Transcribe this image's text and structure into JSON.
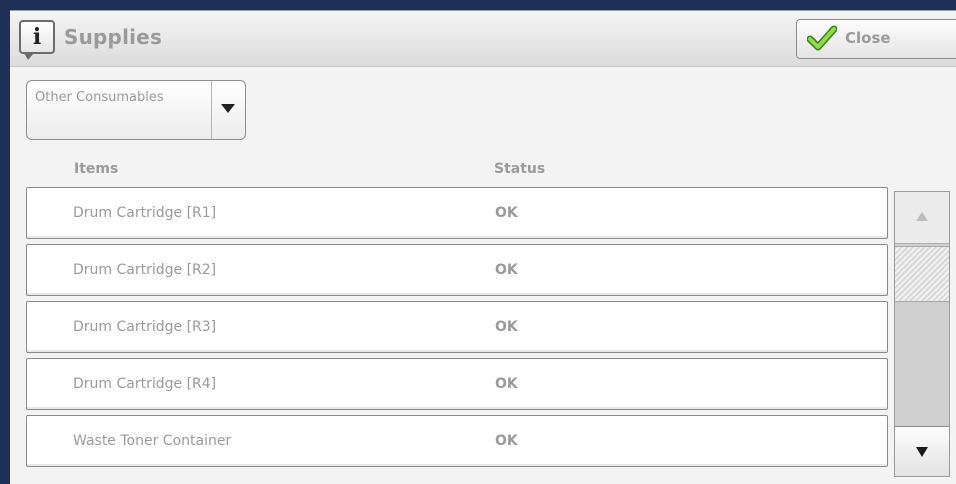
{
  "header": {
    "title": "Supplies",
    "info_icon": "info-icon",
    "close_label": "Close",
    "close_icon": "checkmark-icon"
  },
  "filter": {
    "selected": "Other Consumables"
  },
  "columns": {
    "items": "Items",
    "status": "Status"
  },
  "rows": [
    {
      "item": "Drum Cartridge [R1]",
      "status": "OK"
    },
    {
      "item": "Drum Cartridge [R2]",
      "status": "OK"
    },
    {
      "item": "Drum Cartridge [R3]",
      "status": "OK"
    },
    {
      "item": "Drum Cartridge [R4]",
      "status": "OK"
    },
    {
      "item": "Waste Toner Container",
      "status": "OK"
    }
  ],
  "colors": {
    "frame": "#1f2f55",
    "panel": "#f3f3f3",
    "muted_text": "#9a9a9a",
    "check_green": "#6fc33a"
  }
}
